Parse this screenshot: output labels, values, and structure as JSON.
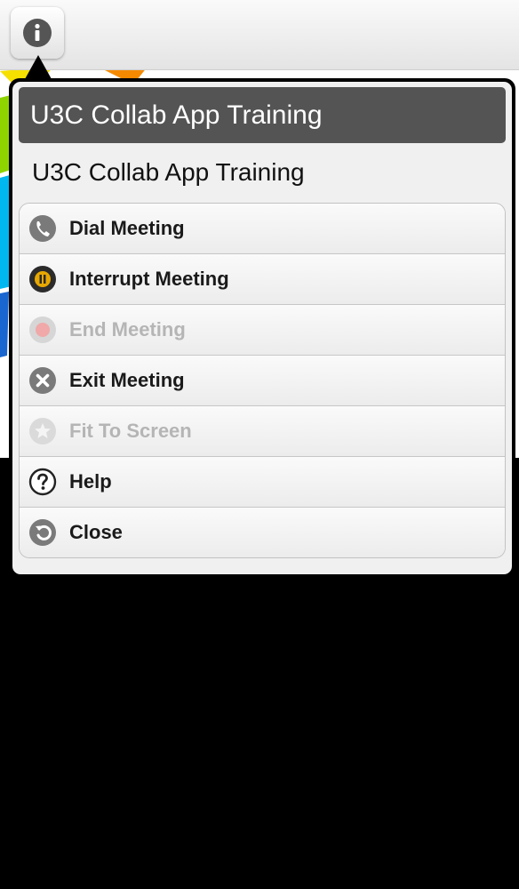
{
  "popover": {
    "title": "U3C Collab App Training",
    "subtitle": "U3C Collab App Training",
    "items": [
      {
        "label": "Dial Meeting",
        "icon": "phone-icon",
        "enabled": true
      },
      {
        "label": "Interrupt Meeting",
        "icon": "pause-icon",
        "enabled": true
      },
      {
        "label": "End Meeting",
        "icon": "stop-icon",
        "enabled": false
      },
      {
        "label": "Exit Meeting",
        "icon": "close-icon",
        "enabled": true
      },
      {
        "label": "Fit To Screen",
        "icon": "star-icon",
        "enabled": false
      },
      {
        "label": "Help",
        "icon": "help-icon",
        "enabled": true
      },
      {
        "label": "Close",
        "icon": "back-arrow-icon",
        "enabled": true
      }
    ]
  },
  "toolbar": {
    "info_button_icon": "info-icon"
  },
  "colors": {
    "title_bar": "#545454",
    "disabled_text": "#b5b5b5",
    "background": "#000000"
  }
}
